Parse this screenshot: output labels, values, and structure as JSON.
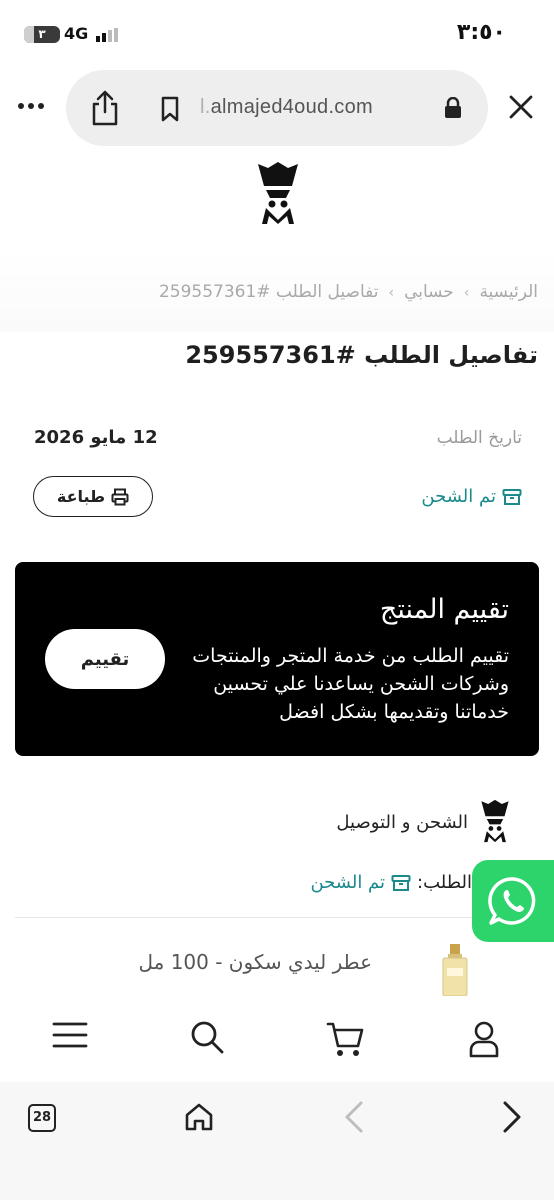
{
  "status_bar": {
    "time": "٣:٥٠",
    "battery": "٣",
    "network": "4G"
  },
  "browser": {
    "url_prefix": "l.",
    "url_domain": "almajed4oud.com"
  },
  "breadcrumb": {
    "home": "الرئيسية",
    "account": "حسابي",
    "current": "تفاصيل الطلب #259557361"
  },
  "page_title": "تفاصيل الطلب #259557361",
  "order": {
    "date_label": "تاريخ الطلب",
    "date_value": "12 مايو 2026",
    "status": "تم الشحن",
    "print_label": "طباعة"
  },
  "rating_card": {
    "title": "تقييم المنتج",
    "body": "تقييم الطلب من خدمة المتجر والمنتجات وشركات الشحن يساعدنا علي تحسين خدماتنا وتقديمها بشكل افضل",
    "button_label": "تقييم"
  },
  "shipping": {
    "title": "الشحن و التوصيل",
    "status_label": "الطلب:",
    "status_value": "تم الشحن"
  },
  "product": {
    "name": "عطر ليدي سكون - 100 مل"
  },
  "browser_toolbar": {
    "tabs_count": "28"
  },
  "colors": {
    "accent_teal": "#1a8a8c",
    "card_bg": "#000000",
    "whatsapp": "#2cd46b"
  }
}
